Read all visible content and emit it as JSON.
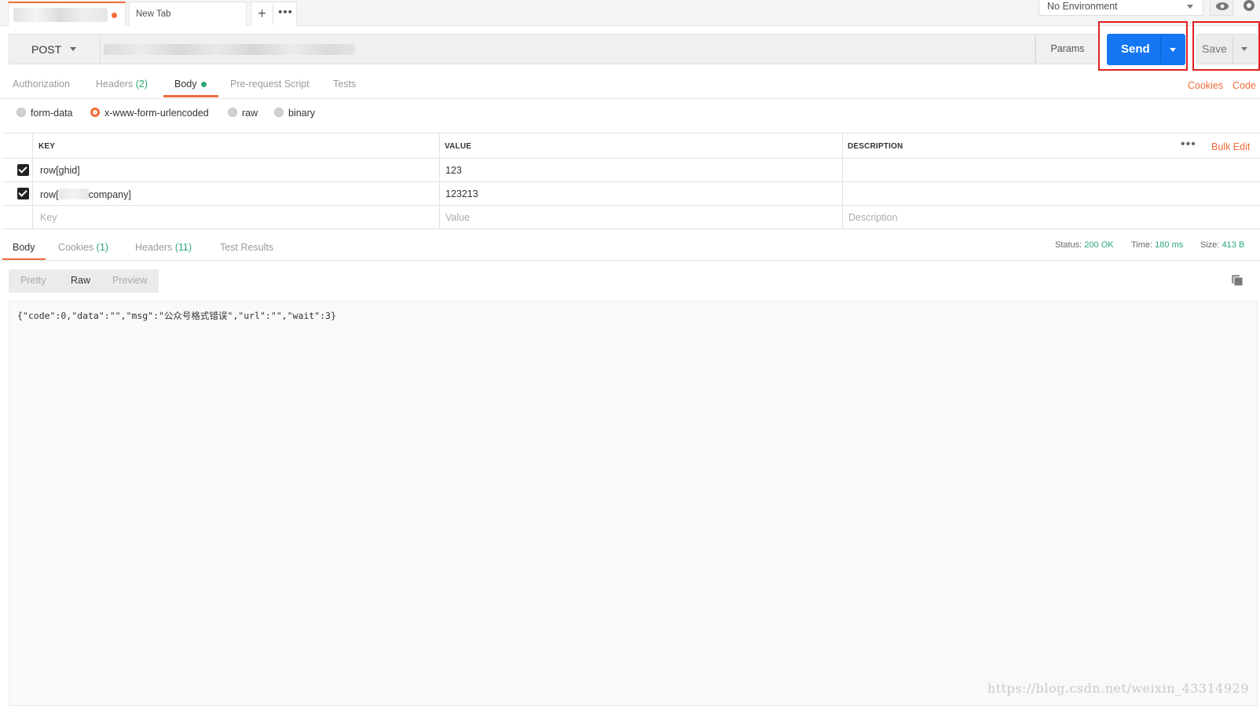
{
  "tabs": {
    "new_tab_label": "New Tab",
    "add_label": "+",
    "more_label": "•••"
  },
  "environment": {
    "selected": "No Environment"
  },
  "request": {
    "method": "POST",
    "params_label": "Params",
    "send_label": "Send",
    "save_label": "Save",
    "cookies_link": "Cookies",
    "code_link": "Code"
  },
  "request_tabs": [
    {
      "label": "Authorization",
      "count": ""
    },
    {
      "label": "Headers",
      "count": "(2)"
    },
    {
      "label": "Body",
      "count": ""
    },
    {
      "label": "Pre-request Script",
      "count": ""
    },
    {
      "label": "Tests",
      "count": ""
    }
  ],
  "body_types": [
    "form-data",
    "x-www-form-urlencoded",
    "raw",
    "binary"
  ],
  "body_type_selected": "x-www-form-urlencoded",
  "kv_table": {
    "headers": [
      "KEY",
      "VALUE",
      "DESCRIPTION"
    ],
    "bulk_edit": "Bulk Edit",
    "more_icon": "•••",
    "rows": [
      {
        "checked": true,
        "key": "row[ghid]",
        "key_prefix": "",
        "key_suffix": "",
        "value": "123",
        "description": ""
      },
      {
        "checked": true,
        "key": "",
        "key_prefix": "row[",
        "key_suffix": "company]",
        "value": "123213",
        "description": ""
      }
    ],
    "placeholders": {
      "key": "Key",
      "value": "Value",
      "description": "Description"
    }
  },
  "response_tabs": [
    {
      "label": "Body",
      "count": ""
    },
    {
      "label": "Cookies",
      "count": "(1)"
    },
    {
      "label": "Headers",
      "count": "(11)"
    },
    {
      "label": "Test Results",
      "count": ""
    }
  ],
  "response_meta": {
    "status_label": "Status:",
    "status_value": "200 OK",
    "time_label": "Time:",
    "time_value": "180 ms",
    "size_label": "Size:",
    "size_value": "413 B"
  },
  "view_modes": [
    "Pretty",
    "Raw",
    "Preview"
  ],
  "view_mode_selected": "Raw",
  "response_body": "{\"code\":0,\"data\":\"\",\"msg\":\"公众号格式错误\",\"url\":\"\",\"wait\":3}",
  "watermark": "https://blog.csdn.net/weixin_43314929",
  "colors": {
    "accent": "#f26b3a",
    "send_blue": "#1476f2",
    "success_green": "#2aa876",
    "highlight_red": "#e0201f"
  }
}
